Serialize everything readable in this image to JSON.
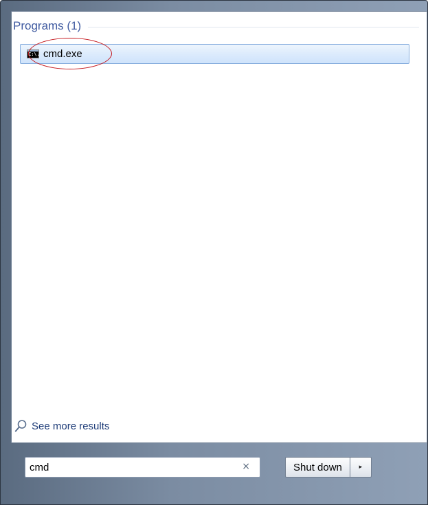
{
  "results": {
    "group_title": "Programs (1)",
    "items": [
      {
        "label": "cmd.exe",
        "icon": "command-prompt-icon",
        "icon_text": "C:\\."
      }
    ]
  },
  "see_more": {
    "label": "See more results",
    "icon": "magnifier-icon"
  },
  "search": {
    "value": "cmd",
    "clear_glyph": "×"
  },
  "power": {
    "shutdown_label": "Shut down",
    "arrow_glyph": "▸"
  },
  "colors": {
    "group_title": "#3f5aa0",
    "selection_border": "#84acdd",
    "annotation_ring": "#c4161c",
    "link": "#1e3c78"
  }
}
